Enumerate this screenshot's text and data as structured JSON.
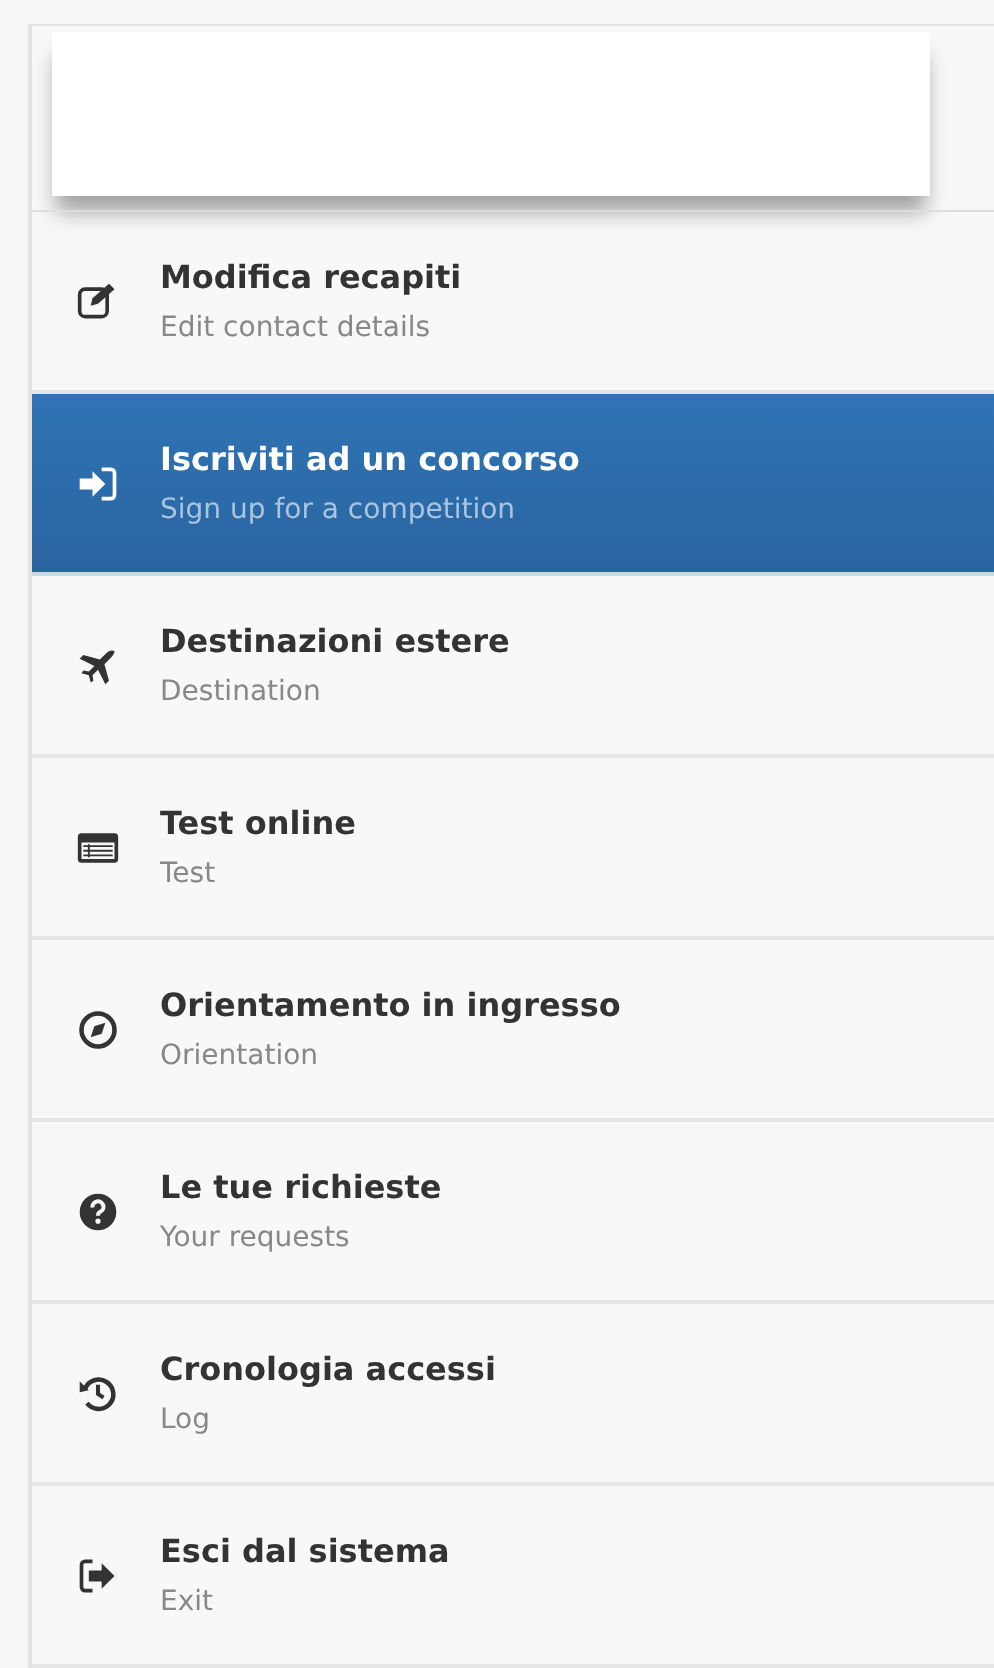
{
  "menu": [
    {
      "title": "Modifica recapiti",
      "subtitle": "Edit contact details",
      "kind": "edit",
      "selected": false
    },
    {
      "title": "Iscriviti ad un concorso",
      "subtitle": "Sign up for a competition",
      "kind": "signin",
      "selected": true
    },
    {
      "title": "Destinazioni estere",
      "subtitle": "Destination",
      "kind": "plane",
      "selected": false
    },
    {
      "title": "Test online",
      "subtitle": "Test",
      "kind": "list",
      "selected": false
    },
    {
      "title": "Orientamento in ingresso",
      "subtitle": "Orientation",
      "kind": "compass",
      "selected": false
    },
    {
      "title": "Le tue richieste",
      "subtitle": "Your requests",
      "kind": "question",
      "selected": false
    },
    {
      "title": "Cronologia accessi",
      "subtitle": "Log",
      "kind": "history",
      "selected": false
    },
    {
      "title": "Esci dal sistema",
      "subtitle": "Exit",
      "kind": "signout",
      "selected": false
    }
  ]
}
